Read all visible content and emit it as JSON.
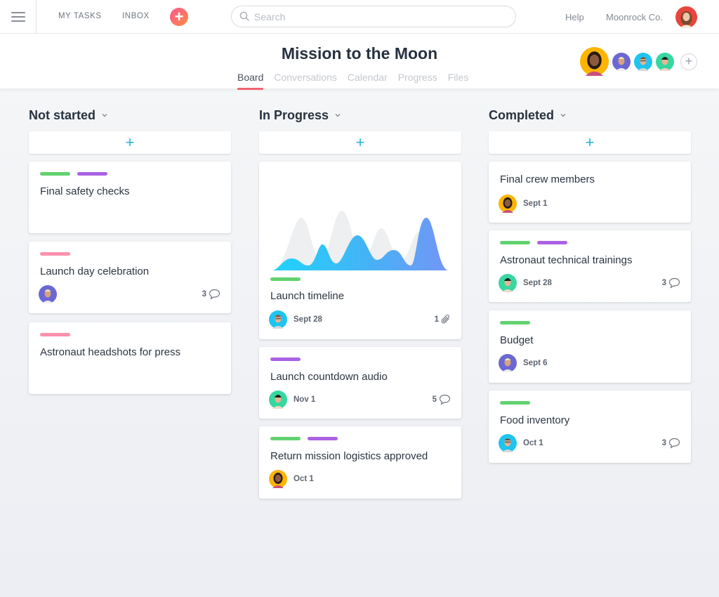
{
  "topbar": {
    "menu_icon": "hamburger-menu-icon",
    "nav": [
      "MY TASKS",
      "INBOX"
    ],
    "add_label": "+",
    "search": {
      "placeholder": "Search",
      "value": ""
    },
    "help": "Help",
    "org": "Moonrock Co."
  },
  "project": {
    "title": "Mission to the Moon",
    "tabs": [
      {
        "label": "Board",
        "active": true
      },
      {
        "label": "Conversations",
        "active": false
      },
      {
        "label": "Calendar",
        "active": false
      },
      {
        "label": "Progress",
        "active": false
      },
      {
        "label": "Files",
        "active": false
      }
    ],
    "add_member_label": "+"
  },
  "colors": {
    "accent_red": "#f0636f",
    "add_plus": "#26b5d9",
    "tag_green": "#62d26f",
    "tag_purple": "#aa62e3",
    "tag_pink": "#fc91ad"
  },
  "columns": [
    {
      "title": "Not started",
      "add_label": "+",
      "cards": [
        {
          "tags": [
            "green",
            "purple"
          ],
          "title": "Final safety checks"
        },
        {
          "tags": [
            "pink"
          ],
          "title": "Launch day celebration",
          "assignee": "purple-avatar",
          "comments": "3"
        },
        {
          "tags": [
            "pink"
          ],
          "title": "Astronaut headshots for press"
        }
      ]
    },
    {
      "title": "In Progress",
      "add_label": "+",
      "cards": [
        {
          "has_chart_image": true,
          "tags": [
            "green"
          ],
          "title": "Launch timeline",
          "assignee": "blue-avatar",
          "due": "Sept 28",
          "attachments": "1"
        },
        {
          "tags": [
            "purple"
          ],
          "title": "Launch countdown audio",
          "assignee": "green-avatar",
          "due": "Nov 1",
          "comments": "5"
        },
        {
          "tags": [
            "green",
            "purple"
          ],
          "title": "Return mission logistics approved",
          "assignee": "yellow-avatar",
          "due": "Oct 1"
        }
      ]
    },
    {
      "title": "Completed",
      "add_label": "+",
      "cards": [
        {
          "tags": [],
          "title": "Final crew members",
          "assignee": "yellow-avatar",
          "due": "Sept 1"
        },
        {
          "tags": [
            "green",
            "purple"
          ],
          "title": "Astronaut technical trainings",
          "assignee": "green-avatar",
          "due": "Sept 28",
          "comments": "3"
        },
        {
          "tags": [
            "green"
          ],
          "title": "Budget",
          "assignee": "purple-avatar",
          "due": "Sept 6"
        },
        {
          "tags": [
            "green"
          ],
          "title": "Food inventory",
          "assignee": "blue-avatar",
          "due": "Oct 1",
          "comments": "3"
        }
      ]
    }
  ]
}
